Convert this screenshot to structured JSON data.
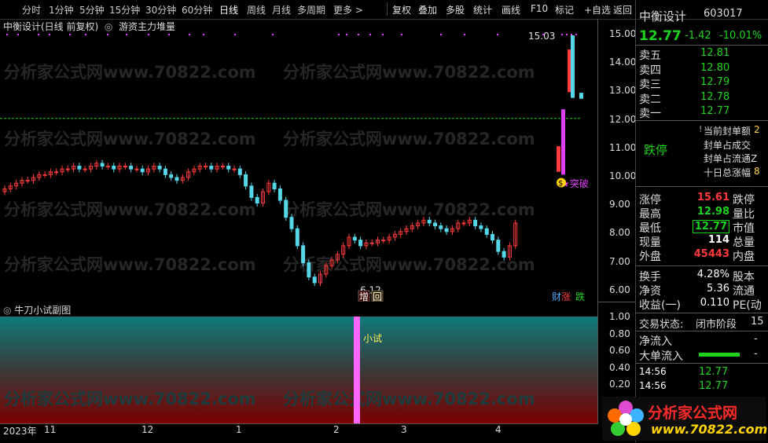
{
  "toolbar": {
    "left_tabs": [
      "分时",
      "1分钟",
      "5分钟",
      "15分钟",
      "30分钟",
      "60分钟",
      "日线",
      "周线",
      "月线",
      "多周期",
      "更多 >"
    ],
    "right_tabs": [
      "复权",
      "叠加",
      "多股",
      "统计",
      "画线",
      "F10",
      "标记",
      "+自选",
      "返回"
    ],
    "active": "日线"
  },
  "chart": {
    "title": "中衡设计(日线 前复权)",
    "indicator": "游资主力堆量",
    "annotations": {
      "high": "15.03",
      "low": "6.12",
      "breakout": "突破",
      "zeng": "增",
      "hui": "回",
      "cai": "财",
      "zhang": "涨",
      "die": "跌",
      "coin": "$"
    },
    "sub_title": "牛刀小试副图",
    "sub_label": "小试",
    "watermark": "分析家公式网www.70822.com"
  },
  "axis": {
    "main_ticks": [
      "15.00",
      "14.00",
      "13.00",
      "12.00",
      "11.00",
      "10.00",
      "9.00",
      "8.00",
      "7.00",
      "6.00"
    ],
    "sub_ticks": [
      "1.00",
      "0.80",
      "0.60",
      "0.40",
      "0.20",
      "0.00"
    ],
    "time_labels": [
      "2023年",
      "11",
      "12",
      "1",
      "2",
      "3",
      "4"
    ]
  },
  "panel": {
    "name": "中衡设计",
    "code": "603017",
    "price": "12.77",
    "change": "-1.42",
    "pct": "-10.01%",
    "asks": [
      {
        "label": "卖五",
        "price": "12.81"
      },
      {
        "label": "卖四",
        "price": "12.80"
      },
      {
        "label": "卖三",
        "price": "12.79"
      },
      {
        "label": "卖二",
        "price": "12.78"
      },
      {
        "label": "卖一",
        "price": "12.77"
      }
    ],
    "limit_state": "跌停",
    "seal_rows": [
      {
        "label": "当前封单额",
        "val": "2"
      },
      {
        "label": "封单占成交",
        "val": ""
      },
      {
        "label": "封单占流通Z",
        "val": ""
      },
      {
        "label": "十日总涨幅",
        "val": "8"
      }
    ],
    "seal_marker": "!",
    "stats": [
      {
        "l1": "涨停",
        "v1": "15.61",
        "c1": "red",
        "l2": "跌停"
      },
      {
        "l1": "最高",
        "v1": "12.98",
        "c1": "green",
        "l2": "量比"
      },
      {
        "l1": "最低",
        "v1": "12.77",
        "c1": "green",
        "l2": "市值"
      },
      {
        "l1": "现量",
        "v1": "114",
        "c1": "white",
        "l2": "总量"
      },
      {
        "l1": "外盘",
        "v1": "45443",
        "c1": "red",
        "l2": "内盘"
      }
    ],
    "stats2": [
      {
        "l1": "换手",
        "v1": "4.28%",
        "l2": "股本"
      },
      {
        "l1": "净资",
        "v1": "5.36",
        "l2": "流通"
      },
      {
        "l1": "收益(一)",
        "v1": "0.110",
        "l2": "PE(动"
      }
    ],
    "trade_state_label": "交易状态:",
    "trade_state": "闭市阶段",
    "trade_state_extra": "15",
    "net_in": "净流入",
    "big_in": "大单流入",
    "net_in_val": "-",
    "big_in_val": "-",
    "ticks": [
      {
        "time": "14:56",
        "price": "12.77"
      },
      {
        "time": "14:56",
        "price": "12.77"
      }
    ],
    "logo_text": "分析家公式网",
    "logo_url": "www.70822.com"
  }
}
